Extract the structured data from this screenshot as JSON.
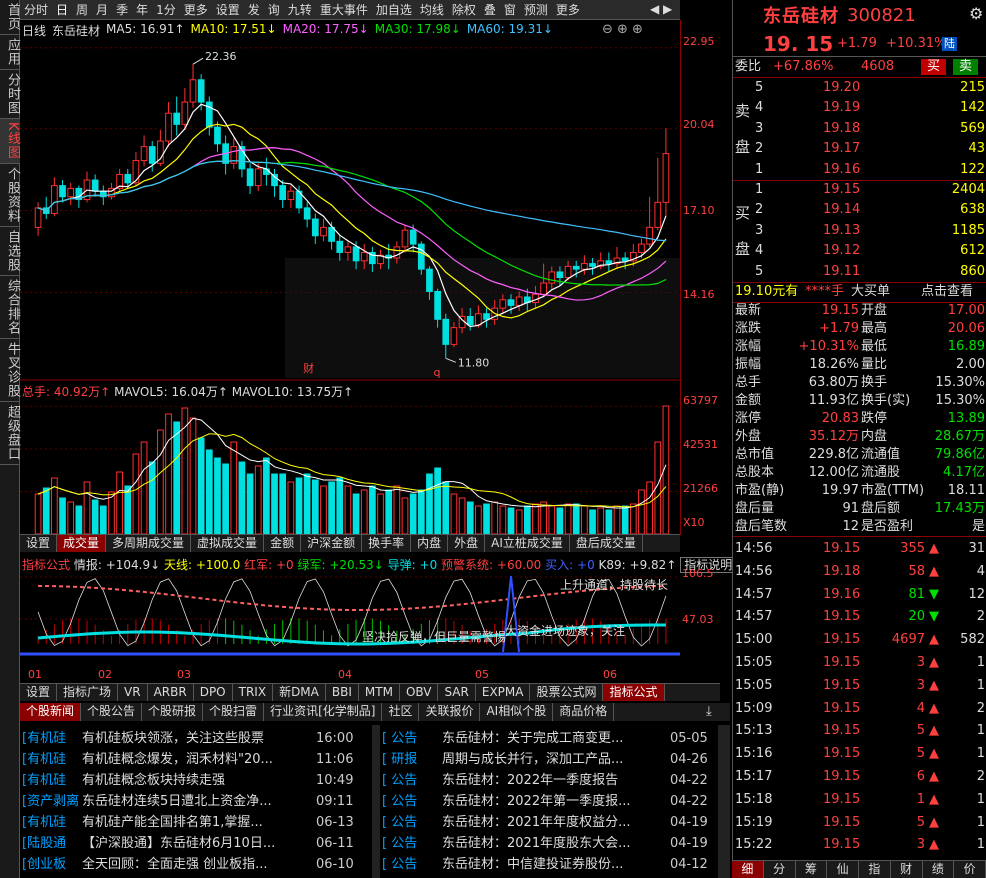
{
  "left_tabs": [
    "首页",
    "应用",
    "分时图",
    "K线图",
    "个股资料",
    "自选股",
    "综合排名",
    "牛叉诊股",
    "超级盘口"
  ],
  "topbar": {
    "items": [
      "分时",
      "日",
      "周",
      "月",
      "季",
      "年",
      "1分",
      "更多",
      "设置",
      "发",
      "询",
      "九转",
      "重大事件",
      "加自选",
      "均线",
      "除权",
      "叠",
      "窗",
      "预测",
      "更多"
    ],
    "active": "日"
  },
  "infoline": {
    "period": "日线",
    "name": "东岳硅材",
    "ma5": "MA5: 16.91↑",
    "ma10": "MA10: 17.51↓",
    "ma20": "MA20: 17.75↓",
    "ma30": "MA30: 17.98↓",
    "ma60": "MA60: 19.31↓"
  },
  "price_axis": [
    "22.95",
    "20.04",
    "17.10",
    "14.16"
  ],
  "price_marks": {
    "high": "22.36",
    "low": "11.80",
    "tag1": "财",
    "tag2": "q"
  },
  "vol_info": {
    "total": "总手: 40.92万↑",
    "mavol5": "MAVOL5: 16.04万↑",
    "mavol10": "MAVOL10: 13.75万↑"
  },
  "vol_axis": [
    "63797",
    "42531",
    "21266",
    "X10"
  ],
  "ind_tabs": [
    "设置",
    "成交量",
    "多周期成交量",
    "虚拟成交量",
    "金额",
    "沪深金额",
    "换手率",
    "内盘",
    "外盘",
    "AI立桩成交量",
    "盘后成交量"
  ],
  "ind_tabs_active": "成交量",
  "ind_info": {
    "name": "指标公式",
    "qb": "情报: +104.9↓",
    "tx": "天线: +100.0",
    "hj": "红军: +0",
    "lj": "绿军: +20.53↓",
    "dd": "导弹: +0",
    "yj": "预警系统: +60.00",
    "mr": "买入: +0",
    "k89": "K89: +9.82↑",
    "help": "指标说明"
  },
  "ind_axis": [
    "106.5",
    "47.03"
  ],
  "ind_notes": [
    "上升通道，持股待长",
    "坚决拾反弹，但巨量需警惕",
    "大资金进场迹象，关注"
  ],
  "months": [
    "01",
    "02",
    "03",
    "04",
    "05",
    "06"
  ],
  "formula_tabs": [
    "设置",
    "指标广场",
    "VR",
    "ARBR",
    "DPO",
    "TRIX",
    "新DMA",
    "BBI",
    "MTM",
    "OBV",
    "SAR",
    "EXPMA",
    "股票公式网",
    "指标公式"
  ],
  "formula_active": "指标公式",
  "news_tabs": [
    "个股新闻",
    "个股公告",
    "个股研报",
    "个股扫雷",
    "行业资讯[化学制品]",
    "社区",
    "关联报价",
    "AI相似个股",
    "商品价格"
  ],
  "news_active": "个股新闻",
  "news_left": [
    {
      "cat": "[有机硅",
      "title": "有机硅板块领涨，关注这些股票",
      "date": "16:00"
    },
    {
      "cat": "[有机硅",
      "title": "有机硅概念爆发，润禾材料\"20...",
      "date": "11:06"
    },
    {
      "cat": "[有机硅",
      "title": "有机硅概念板块持续走强",
      "date": "10:49"
    },
    {
      "cat": "[资产剥离",
      "title": "东岳硅材连续5日遭北上资金净...",
      "date": "09:11"
    },
    {
      "cat": "[有机硅",
      "title": "有机硅产能全国排名第1,掌握...",
      "date": "06-13"
    },
    {
      "cat": "[陆股通",
      "title": "【沪深股通】东岳硅材6月10日...",
      "date": "06-11"
    },
    {
      "cat": "[创业板",
      "title": "全天回顾：全面走强 创业板指...",
      "date": "06-10"
    }
  ],
  "news_right": [
    {
      "cat": "[  公告",
      "title": "东岳硅材：关于完成工商变更...",
      "date": "05-05"
    },
    {
      "cat": "[  研报",
      "title": "周期与成长并行，深加工产品...",
      "date": "04-26"
    },
    {
      "cat": "[  公告",
      "title": "东岳硅材：2022年一季度报告",
      "date": "04-22"
    },
    {
      "cat": "[  公告",
      "title": "东岳硅材：2022年第一季度报...",
      "date": "04-22"
    },
    {
      "cat": "[  公告",
      "title": "东岳硅材：2021年年度权益分...",
      "date": "04-19"
    },
    {
      "cat": "[  公告",
      "title": "东岳硅材：2021年度股东大会...",
      "date": "04-19"
    },
    {
      "cat": "[  公告",
      "title": "东岳硅材：中信建投证券股份...",
      "date": "04-12"
    }
  ],
  "quote": {
    "name": "东岳硅材",
    "code": "300821",
    "price": "19. 15",
    "change": "+1.79",
    "pct": "+10.31%",
    "tag": "陆",
    "wb_label": "委比",
    "wb": "+67.86%",
    "wc": "4608",
    "buy_btn": "买",
    "sell_btn": "卖",
    "sell_label": [
      "卖",
      "盘"
    ],
    "buy_label": [
      "买",
      "盘"
    ],
    "asks": [
      {
        "lv": "5",
        "p": "19.20",
        "v": "215"
      },
      {
        "lv": "4",
        "p": "19.19",
        "v": "142"
      },
      {
        "lv": "3",
        "p": "19.18",
        "v": "569"
      },
      {
        "lv": "2",
        "p": "19.17",
        "v": "43"
      },
      {
        "lv": "1",
        "p": "19.16",
        "v": "122"
      }
    ],
    "bids": [
      {
        "lv": "1",
        "p": "19.15",
        "v": "2404"
      },
      {
        "lv": "2",
        "p": "19.14",
        "v": "638"
      },
      {
        "lv": "3",
        "p": "19.13",
        "v": "1185"
      },
      {
        "lv": "4",
        "p": "19.12",
        "v": "612"
      },
      {
        "lv": "5",
        "p": "19.11",
        "v": "860"
      }
    ],
    "bigorder": {
      "a": "19.10元有",
      "b": "****手",
      "c": "大买单",
      "d": "点击查看"
    },
    "stats": [
      [
        "最新",
        "19.15",
        "开盘",
        "17.00"
      ],
      [
        "涨跌",
        "+1.79",
        "最高",
        "20.06"
      ],
      [
        "涨幅",
        "+10.31%",
        "最低",
        "16.89"
      ],
      [
        "振幅",
        "18.26%",
        "量比",
        "2.00"
      ],
      [
        "总手",
        "63.80万",
        "换手",
        "15.30%"
      ],
      [
        "金额",
        "11.93亿",
        "换手(实)",
        "15.30%"
      ],
      [
        "涨停",
        "20.83",
        "跌停",
        "13.89"
      ],
      [
        "外盘",
        "35.12万",
        "内盘",
        "28.67万"
      ],
      [
        "总市值",
        "229.8亿",
        "流通值",
        "79.86亿"
      ],
      [
        "总股本",
        "12.00亿",
        "流通股",
        "4.17亿"
      ],
      [
        "市盈(静)",
        "19.97",
        "市盈(TTM)",
        "18.11"
      ],
      [
        "盘后量",
        "91",
        "盘后额",
        "17.43万"
      ],
      [
        "盘后笔数",
        "12",
        "是否盈利",
        "是"
      ]
    ],
    "ticks": [
      {
        "t": "14:56",
        "p": "19.15",
        "v": "355",
        "d": "up",
        "n": "31"
      },
      {
        "t": "14:56",
        "p": "19.18",
        "v": "58",
        "d": "up",
        "n": "4"
      },
      {
        "t": "14:57",
        "p": "19.16",
        "v": "81",
        "d": "down",
        "n": "12"
      },
      {
        "t": "14:57",
        "p": "19.15",
        "v": "20",
        "d": "down",
        "n": "2"
      },
      {
        "t": "15:00",
        "p": "19.15",
        "v": "4697",
        "d": "up",
        "n": "582"
      },
      {
        "t": "15:05",
        "p": "19.15",
        "v": "3",
        "d": "up",
        "n": "1"
      },
      {
        "t": "15:05",
        "p": "19.15",
        "v": "3",
        "d": "up",
        "n": "1"
      },
      {
        "t": "15:09",
        "p": "19.15",
        "v": "4",
        "d": "up",
        "n": "2"
      },
      {
        "t": "15:13",
        "p": "19.15",
        "v": "5",
        "d": "up",
        "n": "1"
      },
      {
        "t": "15:16",
        "p": "19.15",
        "v": "5",
        "d": "up",
        "n": "1"
      },
      {
        "t": "15:17",
        "p": "19.15",
        "v": "6",
        "d": "up",
        "n": "2"
      },
      {
        "t": "15:18",
        "p": "19.15",
        "v": "1",
        "d": "up",
        "n": "1"
      },
      {
        "t": "15:19",
        "p": "19.15",
        "v": "5",
        "d": "up",
        "n": "1"
      },
      {
        "t": "15:22",
        "p": "19.15",
        "v": "3",
        "d": "up",
        "n": "1"
      }
    ]
  },
  "bottom_tabs": [
    "细",
    "分",
    "筹",
    "仙",
    "指",
    "财",
    "绩",
    "价"
  ],
  "bottom_active": "细",
  "chart_data": {
    "type": "candlestick",
    "candles": [
      [
        16.5,
        17.2,
        16.2,
        17.4
      ],
      [
        17.2,
        17.0,
        16.8,
        17.6
      ],
      [
        17.0,
        18.0,
        16.9,
        18.3
      ],
      [
        18.0,
        17.6,
        17.4,
        18.2
      ],
      [
        17.6,
        17.9,
        17.3,
        18.1
      ],
      [
        17.9,
        17.5,
        17.2,
        18.0
      ],
      [
        17.5,
        18.2,
        17.4,
        18.5
      ],
      [
        18.2,
        17.8,
        17.6,
        18.4
      ],
      [
        17.8,
        17.6,
        17.3,
        18.0
      ],
      [
        17.6,
        17.9,
        17.5,
        18.1
      ],
      [
        17.9,
        18.4,
        17.8,
        18.6
      ],
      [
        18.4,
        18.1,
        17.9,
        18.6
      ],
      [
        18.1,
        18.9,
        18.0,
        19.2
      ],
      [
        18.9,
        19.4,
        18.7,
        19.8
      ],
      [
        19.4,
        18.8,
        18.5,
        19.6
      ],
      [
        18.8,
        19.6,
        18.7,
        20.0
      ],
      [
        19.6,
        20.6,
        19.4,
        21.0
      ],
      [
        20.6,
        20.2,
        19.8,
        21.2
      ],
      [
        20.2,
        21.0,
        20.0,
        21.5
      ],
      [
        21.0,
        21.8,
        20.8,
        22.36
      ],
      [
        21.8,
        21.0,
        20.7,
        22.0
      ],
      [
        21.0,
        20.1,
        19.8,
        21.2
      ],
      [
        20.1,
        19.5,
        19.2,
        20.3
      ],
      [
        19.5,
        18.8,
        18.4,
        19.8
      ],
      [
        18.8,
        19.4,
        18.6,
        19.7
      ],
      [
        19.4,
        18.6,
        18.3,
        19.6
      ],
      [
        18.6,
        18.0,
        17.7,
        18.8
      ],
      [
        18.0,
        18.6,
        17.8,
        18.8
      ],
      [
        18.6,
        18.4,
        18.0,
        19.0
      ],
      [
        18.4,
        18.0,
        17.6,
        18.6
      ],
      [
        18.0,
        17.5,
        17.2,
        18.2
      ],
      [
        17.5,
        17.8,
        17.2,
        18.0
      ],
      [
        17.8,
        17.2,
        17.0,
        18.0
      ],
      [
        17.2,
        16.8,
        16.5,
        17.4
      ],
      [
        16.8,
        16.2,
        15.9,
        17.0
      ],
      [
        16.2,
        16.5,
        16.0,
        16.8
      ],
      [
        16.5,
        16.0,
        15.7,
        16.7
      ],
      [
        16.0,
        15.6,
        15.3,
        16.2
      ],
      [
        15.6,
        15.8,
        15.3,
        16.0
      ],
      [
        15.8,
        15.3,
        15.0,
        16.0
      ],
      [
        15.3,
        15.6,
        15.0,
        15.9
      ],
      [
        15.6,
        15.2,
        14.9,
        15.8
      ],
      [
        15.2,
        15.5,
        15.0,
        15.7
      ],
      [
        15.5,
        15.4,
        15.0,
        15.9
      ],
      [
        15.4,
        15.8,
        15.2,
        16.0
      ],
      [
        15.8,
        16.4,
        15.6,
        16.6
      ],
      [
        16.4,
        15.9,
        15.6,
        16.6
      ],
      [
        15.9,
        15.0,
        14.8,
        16.0
      ],
      [
        15.0,
        14.2,
        13.9,
        15.1
      ],
      [
        14.2,
        13.2,
        12.9,
        14.3
      ],
      [
        13.2,
        12.3,
        11.8,
        13.4
      ],
      [
        12.3,
        12.9,
        12.2,
        13.1
      ],
      [
        12.9,
        13.3,
        12.7,
        13.6
      ],
      [
        13.3,
        13.0,
        12.8,
        13.6
      ],
      [
        13.0,
        13.4,
        12.9,
        13.7
      ],
      [
        13.4,
        13.2,
        12.9,
        13.6
      ],
      [
        13.2,
        13.6,
        13.0,
        13.9
      ],
      [
        13.6,
        13.9,
        13.4,
        14.1
      ],
      [
        13.9,
        13.7,
        13.4,
        14.1
      ],
      [
        13.7,
        14.0,
        13.5,
        14.2
      ],
      [
        14.0,
        13.8,
        13.5,
        14.3
      ],
      [
        13.8,
        14.1,
        13.6,
        14.4
      ],
      [
        14.1,
        14.5,
        14.0,
        15.2
      ],
      [
        14.5,
        14.9,
        14.3,
        15.1
      ],
      [
        14.9,
        14.7,
        14.4,
        15.1
      ],
      [
        14.7,
        15.1,
        14.6,
        15.3
      ],
      [
        15.1,
        15.0,
        14.7,
        15.3
      ],
      [
        15.0,
        15.2,
        14.8,
        15.5
      ],
      [
        15.2,
        15.1,
        14.8,
        15.4
      ],
      [
        15.1,
        15.3,
        15.0,
        15.6
      ],
      [
        15.3,
        15.2,
        14.9,
        15.6
      ],
      [
        15.2,
        15.4,
        15.0,
        15.8
      ],
      [
        15.4,
        15.3,
        15.0,
        15.6
      ],
      [
        15.3,
        15.6,
        15.1,
        15.9
      ],
      [
        15.6,
        15.9,
        15.4,
        16.1
      ],
      [
        15.9,
        16.5,
        15.8,
        17.6
      ],
      [
        16.5,
        17.4,
        16.4,
        19.0
      ],
      [
        17.4,
        19.15,
        16.9,
        20.06
      ]
    ],
    "volumes": [
      20,
      23,
      28,
      18,
      16,
      14,
      26,
      17,
      14,
      21,
      31,
      24,
      40,
      46,
      36,
      52,
      60,
      56,
      63,
      58,
      48,
      42,
      38,
      35,
      46,
      36,
      30,
      34,
      38,
      30,
      30,
      26,
      28,
      30,
      27,
      24,
      26,
      28,
      24,
      20,
      22,
      24,
      20,
      22,
      24,
      18,
      20,
      22,
      30,
      33,
      26,
      20,
      18,
      16,
      14,
      15,
      16,
      14,
      13,
      12,
      14,
      15,
      16,
      14,
      13,
      15,
      15,
      14,
      12,
      13,
      12,
      14,
      14,
      15,
      22,
      26,
      46,
      64
    ]
  }
}
